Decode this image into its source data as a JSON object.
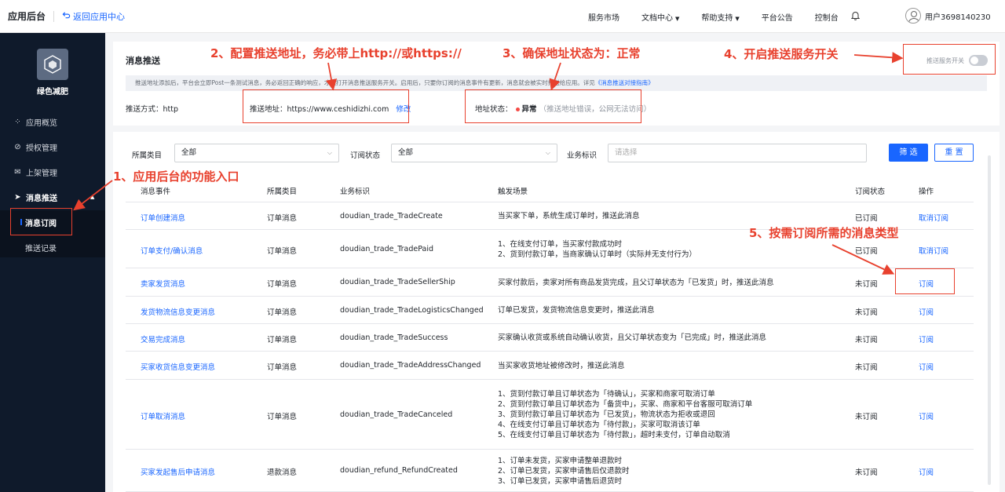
{
  "header": {
    "brand": "应用后台",
    "back_label": "返回应用中心",
    "nav": [
      {
        "label": "服务市场",
        "caret": false
      },
      {
        "label": "文档中心",
        "caret": true
      },
      {
        "label": "帮助支持",
        "caret": true
      },
      {
        "label": "平台公告",
        "caret": false
      },
      {
        "label": "控制台",
        "caret": false
      }
    ],
    "username": "用户3698140230"
  },
  "sidebar": {
    "app_name": "绿色减肥",
    "items": [
      {
        "label": "应用概览",
        "icon": "grid-icon"
      },
      {
        "label": "授权管理",
        "icon": "check-circle-icon"
      },
      {
        "label": "上架管理",
        "icon": "mail-icon"
      },
      {
        "label": "消息推送",
        "icon": "send-icon",
        "expanded": true
      }
    ],
    "sub_items": [
      {
        "label": "消息订阅",
        "active": true
      },
      {
        "label": "推送记录",
        "active": false
      }
    ]
  },
  "push_config": {
    "title": "消息推送",
    "notice": "推送地址添加后，平台会立即Post一条测试消息，务必返回正确的响应，才能打开消息推送服务开关。启用后，只要你订阅的消息事件有更新，消息就会被实时推送给应用。详见",
    "notice_link": "《消息推送对接指南》",
    "switch_label": "推送服务开关",
    "switch_on": false,
    "method_label": "推送方式：",
    "method_value": "http",
    "address_label": "推送地址：",
    "address_value": "https://www.ceshidizhi.com",
    "edit_label": "修改",
    "status_label": "地址状态：",
    "status_value": "异常",
    "status_note": "（推送地址错误，公网无法访问）",
    "status_color": "#f54a45"
  },
  "filters": {
    "category_label": "所属类目",
    "category_value": "全部",
    "sub_status_label": "订阅状态",
    "sub_status_value": "全部",
    "biz_label": "业务标识",
    "biz_placeholder": "请选择",
    "search_button": "筛 选",
    "reset_button": "重 置"
  },
  "table": {
    "columns": [
      "消息事件",
      "所属类目",
      "业务标识",
      "触发场景",
      "订阅状态",
      "操作"
    ],
    "rows": [
      {
        "event": "订单创建消息",
        "category": "订单消息",
        "biz": "doudian_trade_TradeCreate",
        "trigger": [
          "当买家下单，系统生成订单时，推送此消息"
        ],
        "status": "已订阅",
        "action": "取消订阅"
      },
      {
        "event": "订单支付/确认消息",
        "category": "订单消息",
        "biz": "doudian_trade_TradePaid",
        "trigger": [
          "1、在线支付订单，当买家付款成功时",
          "2、货到付款订单，当商家确认订单时（实际并无支付行为）"
        ],
        "status": "已订阅",
        "action": "取消订阅"
      },
      {
        "event": "卖家发货消息",
        "category": "订单消息",
        "biz": "doudian_trade_TradeSellerShip",
        "trigger": [
          "买家付款后，卖家对所有商品发货完成，且父订单状态为「已发货」时，推送此消息"
        ],
        "status": "未订阅",
        "action": "订阅"
      },
      {
        "event": "发货物流信息变更消息",
        "category": "订单消息",
        "biz": "doudian_trade_TradeLogisticsChanged",
        "trigger": [
          "订单已发货，发货物流信息变更时，推送此消息"
        ],
        "status": "未订阅",
        "action": "订阅"
      },
      {
        "event": "交易完成消息",
        "category": "订单消息",
        "biz": "doudian_trade_TradeSuccess",
        "trigger": [
          "买家确认收货或系统自动确认收货，且父订单状态变为「已完成」时，推送此消息"
        ],
        "status": "未订阅",
        "action": "订阅"
      },
      {
        "event": "买家收货信息变更消息",
        "category": "订单消息",
        "biz": "doudian_trade_TradeAddressChanged",
        "trigger": [
          "当买家收货地址被修改时，推送此消息"
        ],
        "status": "未订阅",
        "action": "订阅"
      },
      {
        "event": "订单取消消息",
        "category": "订单消息",
        "biz": "doudian_trade_TradeCanceled",
        "trigger": [
          "1、货到付款订单且订单状态为「待确认」，买家和商家可取消订单",
          "2、货到付款订单且订单状态为「备货中」，买家、商家和平台客服可取消订单",
          "3、货到付款订单且订单状态为「已发货」，物流状态为拒收或退回",
          "4、在线支付订单且订单状态为「待付款」，买家可取消该订单",
          "5、在线支付订单且订单状态为「待付款」，超时未支付，订单自动取消"
        ],
        "status": "未订阅",
        "action": "订阅"
      },
      {
        "event": "买家发起售后申请消息",
        "category": "退款消息",
        "biz": "doudian_refund_RefundCreated",
        "trigger": [
          "1、订单未发货，买家申请整单退款时",
          "2、订单已发货，买家申请售后仅退款时",
          "3、订单已发货，买家申请售后退货时"
        ],
        "status": "未订阅",
        "action": "订阅"
      }
    ]
  },
  "annotations": {
    "a1": "1、应用后台的功能入口",
    "a2": "2、配置推送地址，务必带上http://或https://",
    "a3": "3、确保地址状态为：正常",
    "a4": "4、开启推送服务开关",
    "a5": "5、按需订阅所需的消息类型",
    "color": "#e8412e"
  }
}
